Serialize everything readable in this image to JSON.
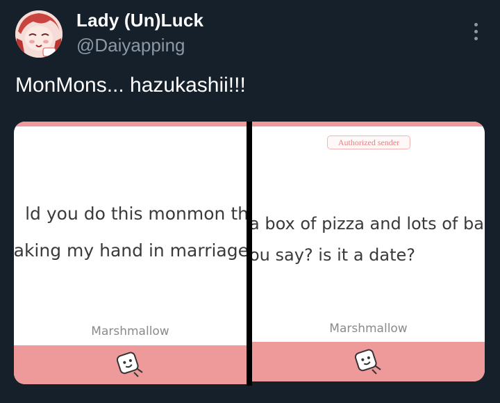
{
  "author": {
    "display_name": "Lady (Un)Luck",
    "handle": "@Daiyapping",
    "avatar_icon": "anime-character-avatar"
  },
  "more_icon": "more-vertical-icon",
  "tweet": {
    "text": "MonMons... hazukashii!!!"
  },
  "images": [
    {
      "lines": [
        "ld you do this monmon th",
        "aking my hand in marriage"
      ],
      "brand": "Marshmallow",
      "icon": "marshmallow-icon"
    },
    {
      "badge": "Authorized sender",
      "lines": [
        "a box of pizza and lots of bac",
        "ou say? is it a date?"
      ],
      "brand": "Marshmallow",
      "icon": "marshmallow-icon"
    }
  ],
  "colors": {
    "background": "#15202b",
    "handle_gray": "#8b98a5",
    "marshmallow_pink": "#ef9a9a"
  }
}
